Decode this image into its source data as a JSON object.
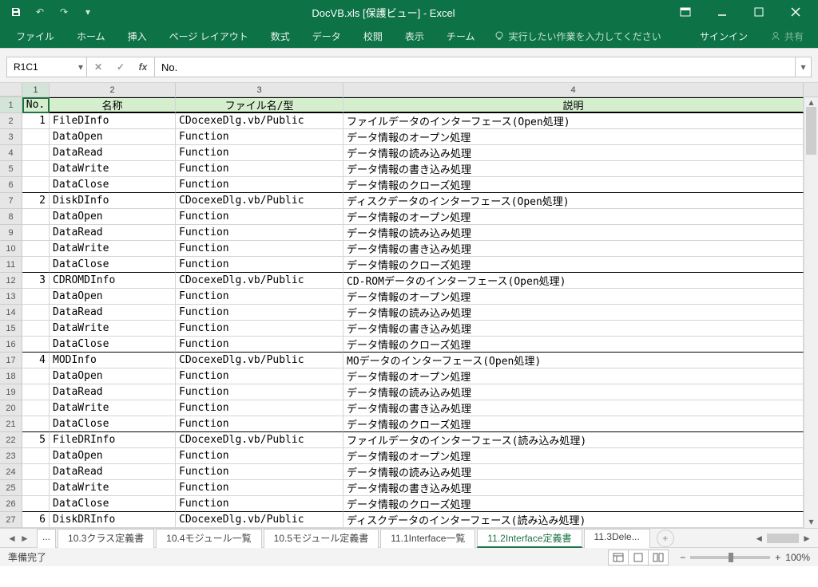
{
  "title": "DocVB.xls  [保護ビュー] - Excel",
  "ribbon": [
    "ファイル",
    "ホーム",
    "挿入",
    "ページ レイアウト",
    "数式",
    "データ",
    "校閲",
    "表示",
    "チーム"
  ],
  "tellme": "実行したい作業を入力してください",
  "signin": "サインイン",
  "share": "共有",
  "namebox": "R1C1",
  "formula": "No.",
  "cols": [
    "1",
    "2",
    "3",
    "4"
  ],
  "headers": {
    "c1": "No.",
    "c2": "名称",
    "c3": "ファイル名/型",
    "c4": "説明"
  },
  "rows": [
    {
      "n": "1",
      "a": "FileDInfo",
      "b": "CDocexeDlg.vb/Public",
      "c": "ファイルデータのインターフェース(Open処理)"
    },
    {
      "n": "",
      "a": "DataOpen",
      "b": "Function",
      "c": "データ情報のオープン処理"
    },
    {
      "n": "",
      "a": "DataRead",
      "b": "Function",
      "c": "データ情報の読み込み処理"
    },
    {
      "n": "",
      "a": "DataWrite",
      "b": "Function",
      "c": "データ情報の書き込み処理"
    },
    {
      "n": "",
      "a": "DataClose",
      "b": "Function",
      "c": "データ情報のクローズ処理",
      "bb": true
    },
    {
      "n": "2",
      "a": "DiskDInfo",
      "b": "CDocexeDlg.vb/Public",
      "c": "ディスクデータのインターフェース(Open処理)"
    },
    {
      "n": "",
      "a": "DataOpen",
      "b": "Function",
      "c": "データ情報のオープン処理"
    },
    {
      "n": "",
      "a": "DataRead",
      "b": "Function",
      "c": "データ情報の読み込み処理"
    },
    {
      "n": "",
      "a": "DataWrite",
      "b": "Function",
      "c": "データ情報の書き込み処理"
    },
    {
      "n": "",
      "a": "DataClose",
      "b": "Function",
      "c": "データ情報のクローズ処理",
      "bb": true
    },
    {
      "n": "3",
      "a": "CDROMDInfo",
      "b": "CDocexeDlg.vb/Public",
      "c": "CD-ROMデータのインターフェース(Open処理)"
    },
    {
      "n": "",
      "a": "DataOpen",
      "b": "Function",
      "c": "データ情報のオープン処理"
    },
    {
      "n": "",
      "a": "DataRead",
      "b": "Function",
      "c": "データ情報の読み込み処理"
    },
    {
      "n": "",
      "a": "DataWrite",
      "b": "Function",
      "c": "データ情報の書き込み処理"
    },
    {
      "n": "",
      "a": "DataClose",
      "b": "Function",
      "c": "データ情報のクローズ処理",
      "bb": true
    },
    {
      "n": "4",
      "a": "MODInfo",
      "b": "CDocexeDlg.vb/Public",
      "c": "MOデータのインターフェース(Open処理)"
    },
    {
      "n": "",
      "a": "DataOpen",
      "b": "Function",
      "c": "データ情報のオープン処理"
    },
    {
      "n": "",
      "a": "DataRead",
      "b": "Function",
      "c": "データ情報の読み込み処理"
    },
    {
      "n": "",
      "a": "DataWrite",
      "b": "Function",
      "c": "データ情報の書き込み処理"
    },
    {
      "n": "",
      "a": "DataClose",
      "b": "Function",
      "c": "データ情報のクローズ処理",
      "bb": true
    },
    {
      "n": "5",
      "a": "FileDRInfo",
      "b": "CDocexeDlg.vb/Public",
      "c": "ファイルデータのインターフェース(読み込み処理)"
    },
    {
      "n": "",
      "a": "DataOpen",
      "b": "Function",
      "c": "データ情報のオープン処理"
    },
    {
      "n": "",
      "a": "DataRead",
      "b": "Function",
      "c": "データ情報の読み込み処理"
    },
    {
      "n": "",
      "a": "DataWrite",
      "b": "Function",
      "c": "データ情報の書き込み処理"
    },
    {
      "n": "",
      "a": "DataClose",
      "b": "Function",
      "c": "データ情報のクローズ処理",
      "bb": true
    },
    {
      "n": "6",
      "a": "DiskDRInfo",
      "b": "CDocexeDlg.vb/Public",
      "c": "ディスクデータのインターフェース(読み込み処理)"
    }
  ],
  "sheettabs": [
    "...",
    "10.3クラス定義書",
    "10.4モジュール一覧",
    "10.5モジュール定義書",
    "11.1Interface一覧",
    "11.2Interface定義書",
    "11.3Dele..."
  ],
  "activeTab": 5,
  "status": "準備完了",
  "zoom": "100%"
}
